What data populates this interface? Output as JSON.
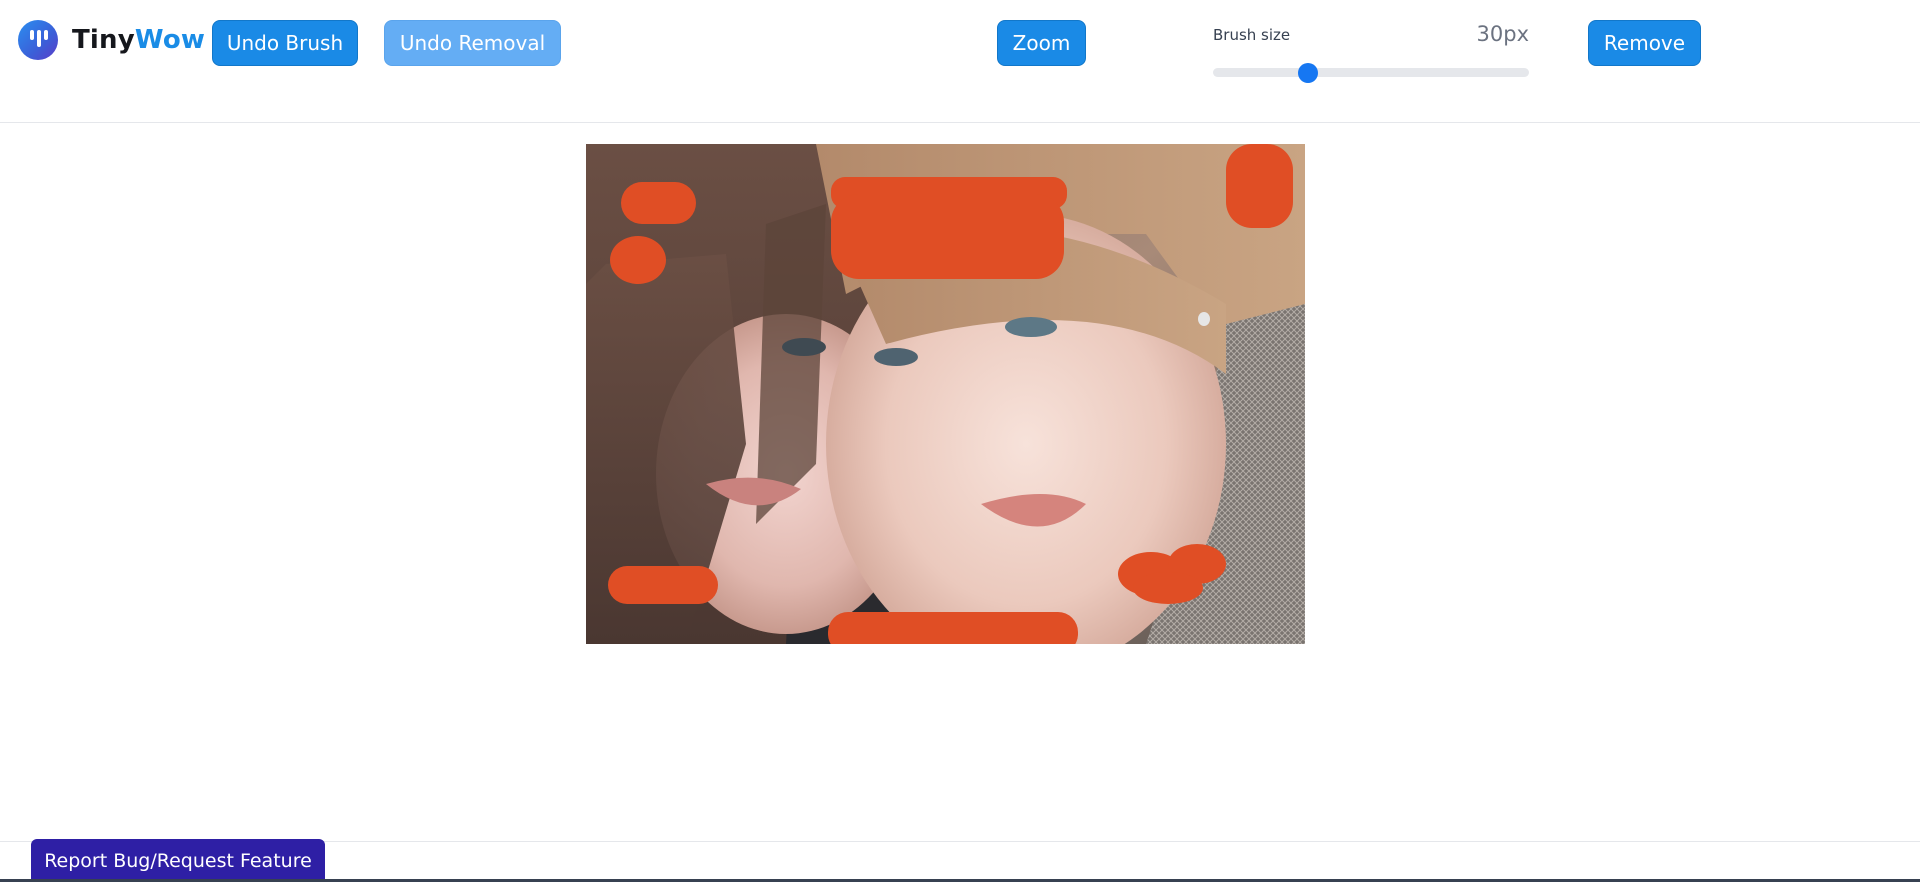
{
  "app": {
    "name_part1": "Tiny",
    "name_part2": "Wow"
  },
  "toolbar": {
    "undo_brush_label": "Undo Brush",
    "undo_removal_label": "Undo Removal",
    "zoom_label": "Zoom",
    "remove_label": "Remove"
  },
  "brush": {
    "label": "Brush size",
    "value_text": "30px",
    "level": 0.3
  },
  "footer": {
    "report_label": "Report Bug/Request Feature"
  },
  "colors": {
    "accent": "#1a8ae6",
    "accent_light": "#64adf4",
    "brush_mask": "#e04e25",
    "report_button": "#2e1fa5",
    "slider_thumb": "#1677f2"
  },
  "icons": {
    "logo": "tinywow-logo-icon"
  }
}
